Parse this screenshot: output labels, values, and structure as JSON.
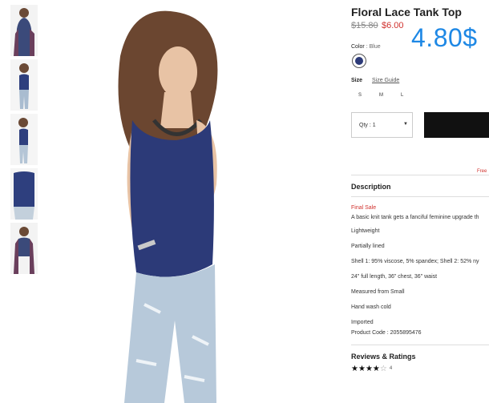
{
  "product": {
    "title": "Floral Lace Tank Top",
    "old_price": "$15.80",
    "new_price": "$6.00",
    "promo_price": "4.80$"
  },
  "color": {
    "label": "Color",
    "separator": ":",
    "value": "Blue",
    "swatch_color": "#2c3a78"
  },
  "size": {
    "label": "Size",
    "guide_label": "Size Guide",
    "options": [
      "S",
      "M",
      "L"
    ]
  },
  "quantity": {
    "label": "Qty : 1"
  },
  "shipping": {
    "free_label": "Free"
  },
  "description": {
    "title": "Description",
    "lines": [
      "Final Sale",
      "A basic knit tank gets a fanciful feminine upgrade th",
      "Lightweight",
      "Partially lined",
      "Shell 1: 95% viscose, 5% spandex; Shell 2: 52% ny",
      "24\" full length, 36\" chest, 36\" waist",
      "Measured from Small",
      "Hand wash cold",
      "Imported",
      "Product Code : 2055895476"
    ]
  },
  "reviews": {
    "title": "Reviews & Ratings",
    "rating": 4,
    "max": 5,
    "count": "4"
  },
  "colors": {
    "accent_blue": "#1e88e5",
    "sale_red": "#d0312d",
    "button_black": "#111111"
  }
}
